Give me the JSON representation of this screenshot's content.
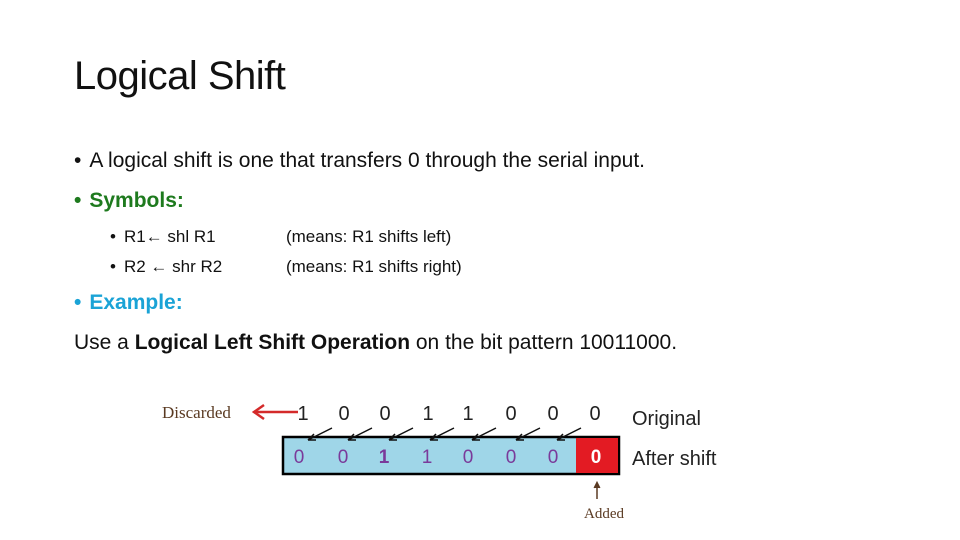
{
  "slide": {
    "title": "Logical Shift",
    "bullets": {
      "b1": "A logical shift is one that transfers 0 through the serial input.",
      "b2": "Symbols:",
      "symbols": [
        {
          "expr": "R1←  shl R1",
          "meaning": "(means: R1 shifts left)"
        },
        {
          "expr": "R2 ← shr R2",
          "meaning": "(means: R1 shifts right)"
        }
      ],
      "b3": "Example:",
      "example_pre": "Use a ",
      "example_bold": "Logical Left Shift Operation",
      "example_post": " on the bit pattern 10011000."
    },
    "bullet_char": "•",
    "colors": {
      "symbols_heading": "#1e7a1e",
      "example_heading": "#1aa3d6",
      "register_fill": "#9fd6e8",
      "added_fill": "#e31b23",
      "discard_arrow": "#d42a2a",
      "shifted_bits": "#7a3a9a"
    }
  },
  "diagram": {
    "discarded_label": "Discarded",
    "original_label": "Original",
    "after_label": "After shift",
    "added_label": "Added",
    "original_bits": [
      "1",
      "0",
      "0",
      "1",
      "1",
      "0",
      "0",
      "0"
    ],
    "shifted_bits": [
      "0",
      "0",
      "1",
      "1",
      "0",
      "0",
      "0",
      "0"
    ]
  }
}
